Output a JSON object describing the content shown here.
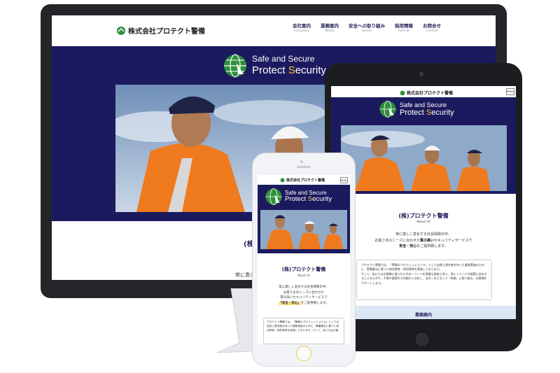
{
  "company": {
    "logo_text": "株式会社プロテクト警備",
    "tagline_1": "Safe and Secure",
    "tagline_2_pre": "Protect ",
    "tagline_2_s": "S",
    "tagline_2_post": "ecurity"
  },
  "nav": [
    {
      "ja": "会社案内",
      "en": "Company"
    },
    {
      "ja": "業務案内",
      "en": "Works"
    },
    {
      "ja": "安全への取り組み",
      "en": "Safety"
    },
    {
      "ja": "採用情報",
      "en": "Recruit"
    },
    {
      "ja": "お問合せ",
      "en": "Contact"
    }
  ],
  "menu_label": "MENU",
  "about": {
    "title": "(株)プロテクト警備",
    "title_cut": "(株",
    "subtitle": "About Us",
    "lead_1": "常に激しく変化する社会情勢の中、",
    "lead_2_pre": "お客さまのニーズに合わせた",
    "lead_2_hl": "質の高い",
    "lead_2_post": "セキュリティサービスで",
    "lead_3_hl": "安全・安心",
    "lead_3_post": "をご提供致します。",
    "desktop_cut": "常に激し",
    "phone_lead_2": "お客さまのニーズに合わせた",
    "phone_lead_3": "質の高いセキュリティサービスで",
    "phone_lead_4_hl": "「安全・安心」",
    "phone_lead_4_post": "をご提供致します。",
    "body_tablet_1": "プロテクト警備では、「警備のプロフェッショナル」として自覚と責任感を持った業務実施のために、警備業法に基づく新任教育・現任教育を実施しております。",
    "body_tablet_2": "そして、私どもはお客様に限られた中の一つ一つを貴重な財産と考え、常に一人一人が誠実に対応することを心がけ、不満や要望をきめ細かく分析し、全社一丸となって「体質」に取り組み、お客様をサポートします。",
    "body_phone": "プロテクト警備では、「警備のプロフェッショナル」としての自覚と責任感を持った業務実施のために、警備業法に基づく新任教育・現任教育を実施しております。そして、私どもはお客"
  },
  "works_label": "業務案内"
}
